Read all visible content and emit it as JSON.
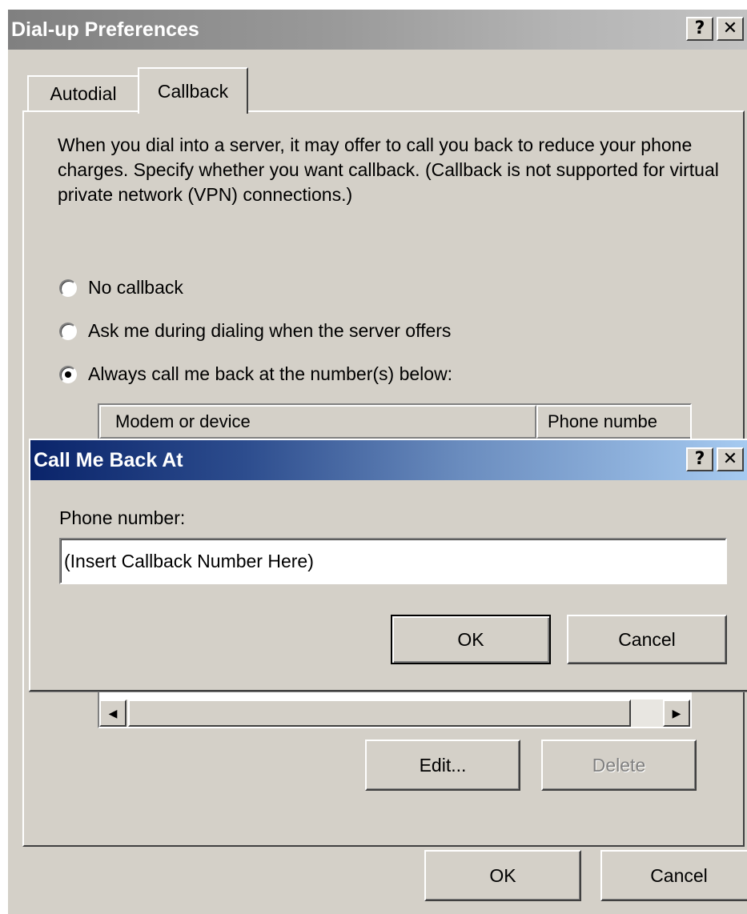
{
  "main_window": {
    "title": "Dial-up Preferences",
    "help_glyph": "?",
    "close_glyph": "✕",
    "tabs": [
      {
        "label": "Autodial",
        "selected": false
      },
      {
        "label": "Callback",
        "selected": true
      }
    ],
    "description": "When you dial into a server, it may offer to call you back to reduce your phone charges.  Specify whether you want callback. (Callback is not supported for virtual private network (VPN) connections.)",
    "options": [
      {
        "label": "No callback",
        "selected": false
      },
      {
        "label": "Ask me during dialing when the server offers",
        "selected": false
      },
      {
        "label": "Always call me back at the number(s) below:",
        "selected": true
      }
    ],
    "list": {
      "columns": [
        "Modem or device",
        "Phone numbe"
      ]
    },
    "buttons": {
      "edit": "Edit...",
      "delete": "Delete",
      "ok": "OK",
      "cancel": "Cancel"
    }
  },
  "callback_dialog": {
    "title": "Call Me Back At",
    "help_glyph": "?",
    "close_glyph": "✕",
    "phone_label": "Phone number:",
    "phone_value": "(Insert Callback Number Here)",
    "buttons": {
      "ok": "OK",
      "cancel": "Cancel"
    }
  },
  "icons": {
    "scroll_left": "◀",
    "scroll_right": "▶"
  },
  "colors": {
    "face": "#d4d0c8",
    "active_title_start": "#0a246a",
    "active_title_end": "#a6caf0",
    "inactive_title": "#808080"
  }
}
